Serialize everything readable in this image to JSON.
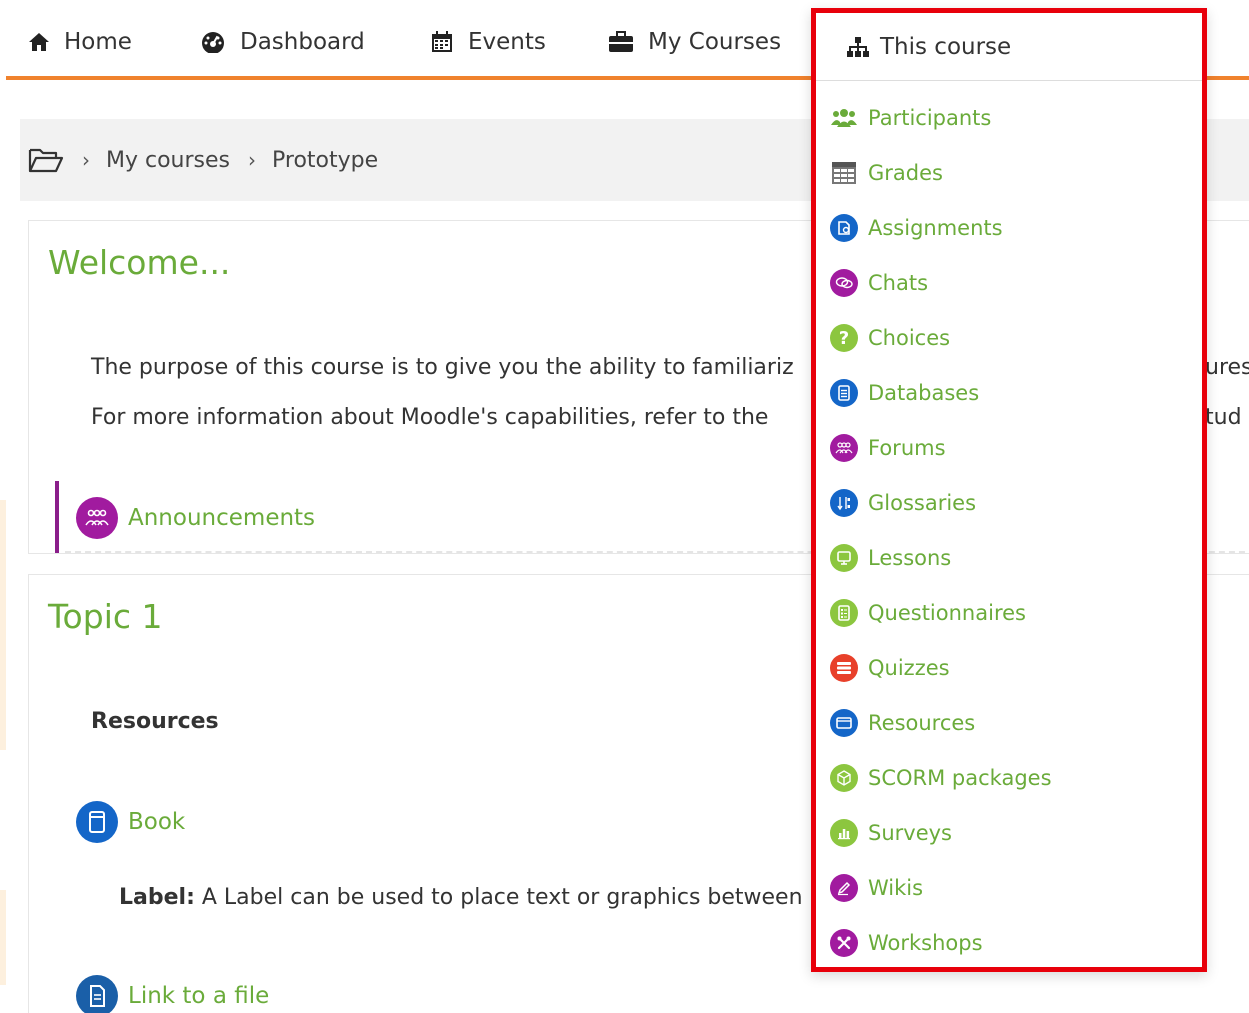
{
  "nav": {
    "home": "Home",
    "dashboard": "Dashboard",
    "events": "Events",
    "my_courses": "My Courses",
    "this_course": "This course"
  },
  "breadcrumb": {
    "items": [
      "My courses",
      "Prototype"
    ],
    "separator": "›"
  },
  "welcome": {
    "title": "Welcome...",
    "line1": "The purpose of this course is to give you the ability to familiariz",
    "line1_tail": "ures",
    "line2": "For more information about Moodle's capabilities, refer to the",
    "line2_tail": "tud",
    "announcements": "Announcements"
  },
  "topic1": {
    "title": "Topic 1",
    "resources_heading": "Resources",
    "book": "Book",
    "label_prefix": "Label:",
    "label_text": " A Label can be used to place text or graphics between",
    "link_file": "Link to a file"
  },
  "dropdown": {
    "title": "This course",
    "items": [
      {
        "label": "Participants",
        "icon": "users-icon",
        "color": "#6aab3a"
      },
      {
        "label": "Grades",
        "icon": "grades-table-icon",
        "color": "#777777"
      },
      {
        "label": "Assignments",
        "icon": "assignment-icon",
        "color": "#1466c8"
      },
      {
        "label": "Chats",
        "icon": "chat-icon",
        "color": "#a11b9f"
      },
      {
        "label": "Choices",
        "icon": "question-icon",
        "color": "#8cc63f"
      },
      {
        "label": "Databases",
        "icon": "database-icon",
        "color": "#1466c8"
      },
      {
        "label": "Forums",
        "icon": "forum-icon",
        "color": "#a11b9f"
      },
      {
        "label": "Glossaries",
        "icon": "glossary-icon",
        "color": "#1466c8"
      },
      {
        "label": "Lessons",
        "icon": "lesson-icon",
        "color": "#8cc63f"
      },
      {
        "label": "Questionnaires",
        "icon": "questionnaire-icon",
        "color": "#8cc63f"
      },
      {
        "label": "Quizzes",
        "icon": "quiz-icon",
        "color": "#e8402a"
      },
      {
        "label": "Resources",
        "icon": "resource-icon",
        "color": "#1466c8"
      },
      {
        "label": "SCORM packages",
        "icon": "scorm-icon",
        "color": "#8cc63f"
      },
      {
        "label": "Surveys",
        "icon": "survey-icon",
        "color": "#8cc63f"
      },
      {
        "label": "Wikis",
        "icon": "wiki-icon",
        "color": "#a11b9f"
      },
      {
        "label": "Workshops",
        "icon": "workshop-icon",
        "color": "#a11b9f"
      }
    ]
  },
  "colors": {
    "accent_orange": "#f0822d",
    "link_green": "#6aab3a",
    "highlight_red": "#e8000b"
  }
}
